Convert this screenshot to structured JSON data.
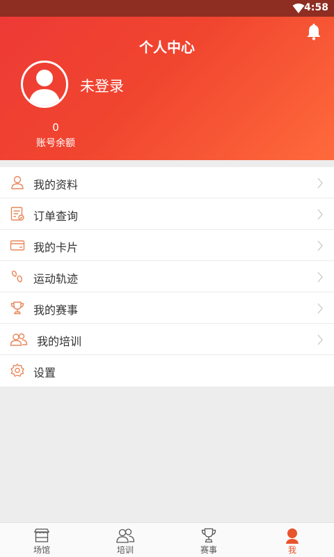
{
  "status_bar": {
    "time": "4:58"
  },
  "header": {
    "title": "个人中心",
    "login_text": "未登录",
    "balance_value": "0",
    "balance_label": "账号余额"
  },
  "menu": {
    "items": [
      {
        "label": "我的资料",
        "icon": "user-icon"
      },
      {
        "label": "订单查询",
        "icon": "order-list-icon"
      },
      {
        "label": "我的卡片",
        "icon": "card-icon"
      },
      {
        "label": "运动轨迹",
        "icon": "footprint-icon"
      },
      {
        "label": "我的赛事",
        "icon": "trophy-icon"
      },
      {
        "label": "我的培训",
        "icon": "group-icon"
      },
      {
        "label": "设置",
        "icon": "gear-icon"
      }
    ]
  },
  "tabbar": {
    "tabs": [
      {
        "label": "场馆",
        "icon": "venue-icon"
      },
      {
        "label": "培训",
        "icon": "group-icon"
      },
      {
        "label": "赛事",
        "icon": "trophy-icon"
      },
      {
        "label": "我",
        "icon": "me-icon"
      }
    ],
    "active_index": 3
  },
  "colors": {
    "accent": "#e8542c",
    "header_start": "#ee3a36",
    "header_end": "#ff6a3c",
    "status_bar": "#8e2d22",
    "icon": "#e8875a"
  }
}
